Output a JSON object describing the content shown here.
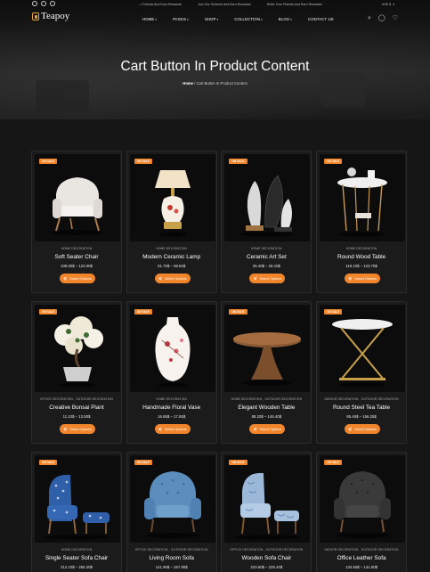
{
  "topbar": {
    "ticker": [
      "...r Friends And Earn Rewards!",
      "Join Our Scheme And Earn Rewards!",
      "Refer Your Friends And Earn Rewards!"
    ],
    "currency": "USD $"
  },
  "brand": {
    "name": "Teapoy"
  },
  "nav": {
    "items": [
      "HOME",
      "PAGES",
      "SHOP",
      "COLLECTION",
      "BLOG",
      "CONTACT US"
    ],
    "icons": [
      "search-icon",
      "user-icon",
      "heart-icon"
    ]
  },
  "hero": {
    "title": "Cart Button In Product Content",
    "breadcrumb_home": "Home",
    "breadcrumb_current": "Cart Button In Product Content"
  },
  "products": [
    {
      "badge": "ON SALE",
      "category": "HOME DECORATION",
      "name": "Soft Seater Chair",
      "price": "108.00$ – 123.00$",
      "button": "Select Options",
      "art": "armchair-white"
    },
    {
      "badge": "ON SALE",
      "category": "HOME DECORATION",
      "name": "Modern Ceramic Lamp",
      "price": "51.70$ – 58.50$",
      "button": "Select Options",
      "art": "lamp"
    },
    {
      "badge": "ON SALE",
      "category": "HOME DECORATION",
      "name": "Ceramic Art Set",
      "price": "25.40$ – 26.10$",
      "button": "Select Options",
      "art": "sculpture"
    },
    {
      "badge": "ON SALE",
      "category": "HOME DECORATION",
      "name": "Round Wood Table",
      "price": "119.10$ – 123.70$",
      "button": "Select Options",
      "art": "side-table"
    },
    {
      "badge": "ON SALE",
      "category": "OFFICE DECORATION , OUTDOOR DECORATION",
      "name": "Creative Bonsai Plant",
      "price": "11.10$ – 13.50$",
      "button": "Select Options",
      "art": "bonsai"
    },
    {
      "badge": "ON SALE",
      "category": "HOME DECORATION",
      "name": "Handmade Floral Vase",
      "price": "16.65$ – 17.85$",
      "button": "Select Options",
      "art": "vase"
    },
    {
      "badge": "ON SALE",
      "category": "HOME DECORATION , OUTDOOR DECORATION",
      "name": "Elegant Wooden Table",
      "price": "88.20$ – 146.40$",
      "button": "Select Options",
      "art": "wood-table"
    },
    {
      "badge": "ON SALE",
      "category": "INDOOR DECORATION , OUTDOOR DECORATION",
      "name": "Round Steel Tea Table",
      "price": "85.45$ – 156.25$",
      "button": "Select Options",
      "art": "steel-table"
    },
    {
      "badge": "ON SALE",
      "category": "HOME DECORATION",
      "name": "Single Seater Sofa Chair",
      "price": "212.10$ – 255.20$",
      "button": "Select Options",
      "art": "blue-chair-ottoman"
    },
    {
      "badge": "ON SALE",
      "category": "OFFICE DECORATION , OUTDOOR DECORATION",
      "name": "Living Room Sofa",
      "price": "141.90$ – 167.90$",
      "button": "Select Options",
      "art": "blue-tufted-chair"
    },
    {
      "badge": "ON SALE",
      "category": "OFFICE DECORATION , OUTDOOR DECORATION",
      "name": "Wooden Sofa Chair",
      "price": "223.60$ – 225.40$",
      "button": "Select Options",
      "art": "pattern-chair-ottoman"
    },
    {
      "badge": "ON SALE",
      "category": "INDOOR DECORATION , OUTDOOR DECORATION",
      "name": "Office Leather Sofa",
      "price": "134.50$ – 141.50$",
      "button": "Select Options",
      "art": "leather-chair"
    }
  ],
  "colors": {
    "accent": "#f0852c",
    "background": "#161616",
    "card": "#1b1b1b"
  }
}
